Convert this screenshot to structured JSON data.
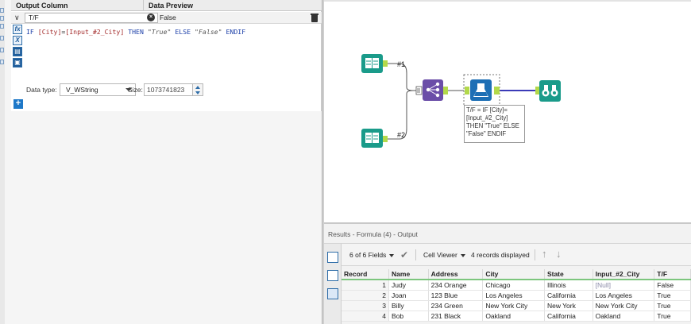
{
  "config": {
    "header_output_column": "Output Column",
    "header_data_preview": "Data Preview",
    "output_column_value": "T/F",
    "preview_value": "False",
    "expression": {
      "kw_if": "IF",
      "field_city": "[City]",
      "op_eq": "=",
      "field_input2": "[Input_#2_City]",
      "kw_then": "THEN",
      "str_true": "\"True\"",
      "kw_else": "ELSE",
      "str_false": "\"False\"",
      "kw_endif": "ENDIF"
    },
    "data_type_label": "Data type:",
    "data_type_value": "V_WString",
    "size_label": "Size:",
    "size_value": "1073741823"
  },
  "canvas": {
    "connection_label_1": "#1",
    "connection_label_2": "#2",
    "annotation_lines": [
      "T/F = IF [City]=",
      "[Input_#2_City]",
      "THEN \"True\" ELSE",
      "\"False\" ENDIF"
    ],
    "colors": {
      "input_tool": "#1a9b8a",
      "join_tool": "#6b4ea8",
      "formula_tool": "#1d6fb5",
      "browse_tool": "#1a9b8a",
      "anchor": "#b3d94a",
      "connector": "#3b3bb8"
    }
  },
  "results": {
    "title": "Results - Formula (4) - Output",
    "fields_count": "6 of 6 Fields",
    "viewer": "Cell Viewer",
    "records_displayed": "4 records displayed",
    "columns": [
      "Record",
      "Name",
      "Address",
      "City",
      "State",
      "Input_#2_City",
      "T/F"
    ],
    "rows": [
      [
        "1",
        "Judy",
        "234 Orange",
        "Chicago",
        "Illinois",
        "[Null]",
        "False"
      ],
      [
        "2",
        "Joan",
        "123 Blue",
        "Los Angeles",
        "California",
        "Los Angeles",
        "True"
      ],
      [
        "3",
        "Billy",
        "234 Green",
        "New York City",
        "New York",
        "New York City",
        "True"
      ],
      [
        "4",
        "Bob",
        "231 Black",
        "Oakland",
        "California",
        "Oakland",
        "True"
      ]
    ]
  }
}
